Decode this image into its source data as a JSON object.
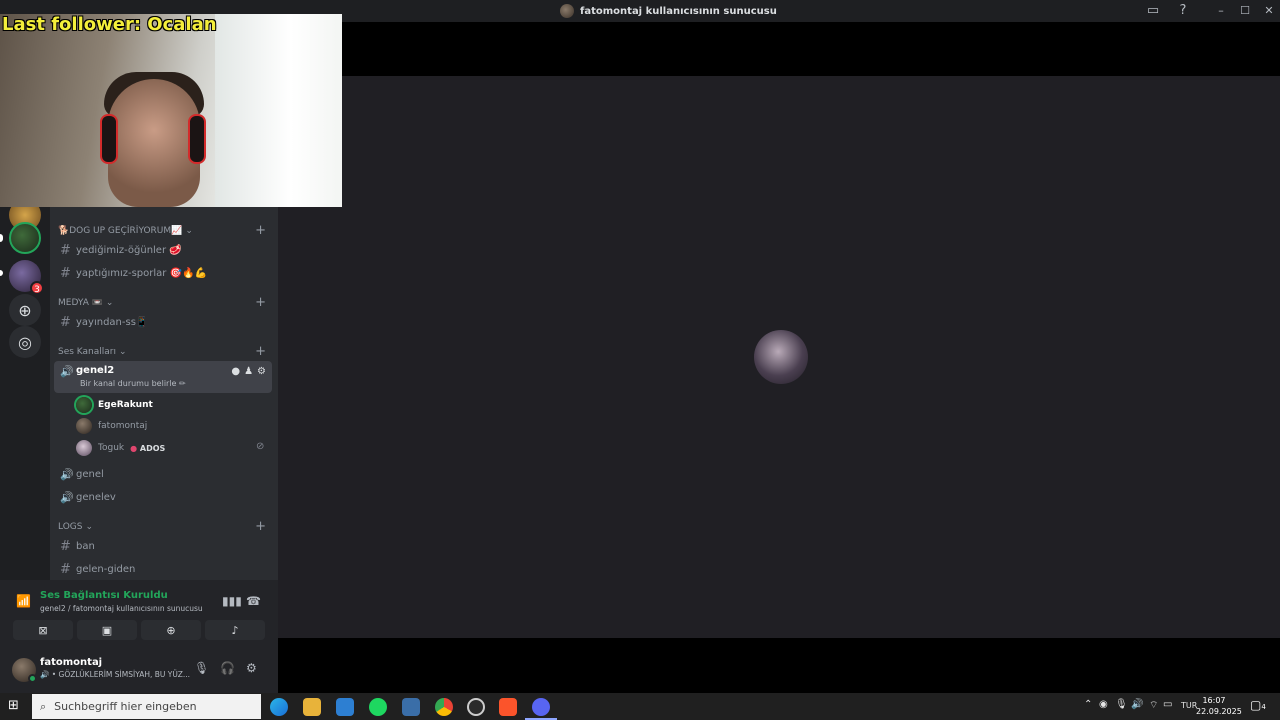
{
  "window": {
    "title": "fatomontaj kullanıcısının sunucusu"
  },
  "webcam_overlay": {
    "label": "Last follower: Ocalan"
  },
  "servers": {
    "badge_count": "3"
  },
  "channels": {
    "categories": [
      {
        "label": "🐕DOG UP GEÇİRİYORUM📈"
      },
      {
        "label": "MEDYA 📼"
      },
      {
        "label": "Ses Kanalları"
      },
      {
        "label": "LOGS"
      }
    ],
    "text_channels": {
      "c1": "yediğimiz-öğünler 🥩",
      "c2": "yaptığımız-sporlar 🎯🔥💪",
      "c3": "yayından-ss📱",
      "c4": "ban",
      "c5": "gelen-giden"
    },
    "voice_active": {
      "name": "genel2",
      "subtitle": "Bir kanal durumu belirle ✏"
    },
    "voice_users": [
      {
        "name": "EgeRakunt"
      },
      {
        "name": "fatomontaj"
      },
      {
        "name": "Toguk",
        "tag": "ADOS"
      }
    ],
    "voice_channels": {
      "v2": "genel",
      "v3": "genelev"
    }
  },
  "voice_bar": {
    "status": "Ses Bağlantısı Kuruldu",
    "subtitle": "genel2 / fatomontaj kullanıcısının sunucusu"
  },
  "user_bar": {
    "name": "fatomontaj",
    "custom_status": "🔊 • GÖZLÜKLERİM SİMSİYAH, BU YÜZ..."
  },
  "taskbar": {
    "search_placeholder": "Suchbegriff hier eingeben",
    "language": "TUR",
    "time": "16:07",
    "date": "22.09.2025",
    "notification_count": "4"
  },
  "colors": {
    "accent_green": "#23a55a",
    "overlay_text": "#f4ef3b",
    "stage_bg": "#201f24"
  }
}
